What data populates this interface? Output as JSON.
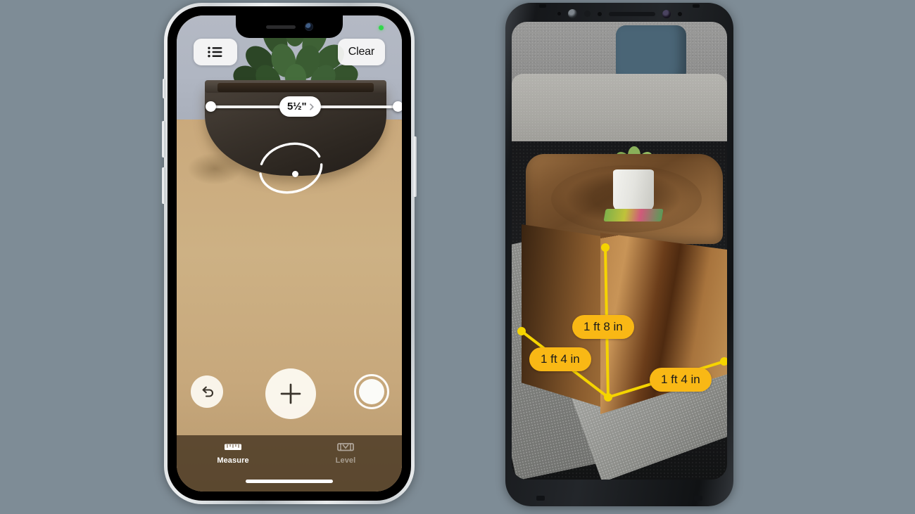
{
  "background_color": "#7e8c96",
  "devices": [
    {
      "name": "iphone",
      "platform": "iOS",
      "app": "Measure",
      "top_controls": {
        "list_button_icon": "list-bullet-icon",
        "clear_button_label": "Clear"
      },
      "ar_overlay": {
        "measurement_label": "5½\"",
        "chevron_icon": "chevron-right-icon",
        "reticle_icon": "ar-reticle-ellipse-icon",
        "endpoint_icon": "measurement-endpoint-dot"
      },
      "bottom_controls": {
        "undo_icon": "undo-arrow-icon",
        "add_icon": "plus-icon",
        "shutter_icon": "camera-shutter-icon"
      },
      "tabs": [
        {
          "label": "Measure",
          "icon": "ruler-icon",
          "active": true
        },
        {
          "label": "Level",
          "icon": "bubble-level-icon",
          "active": false
        }
      ],
      "status_indicators": {
        "camera_privacy_dot_color": "#32d74b"
      },
      "home_indicator": true,
      "scene_description_icons": {
        "subject": "succulent-in-planter",
        "surface": "wood-table"
      }
    },
    {
      "name": "android",
      "platform": "Android",
      "app": "AR Measure",
      "accent_color": "#f9b815",
      "ar_overlay": {
        "line_color": "#f5d400",
        "labels": [
          {
            "text": "1 ft 8 in",
            "axis": "height"
          },
          {
            "text": "1 ft 4 in",
            "axis": "depth"
          },
          {
            "text": "1 ft 4 in",
            "axis": "width"
          }
        ]
      },
      "scene_description_icons": {
        "subject": "wooden-block-side-table",
        "decor": "potted-succulent",
        "background": "gray-couch-with-blue-pillow"
      }
    }
  ]
}
